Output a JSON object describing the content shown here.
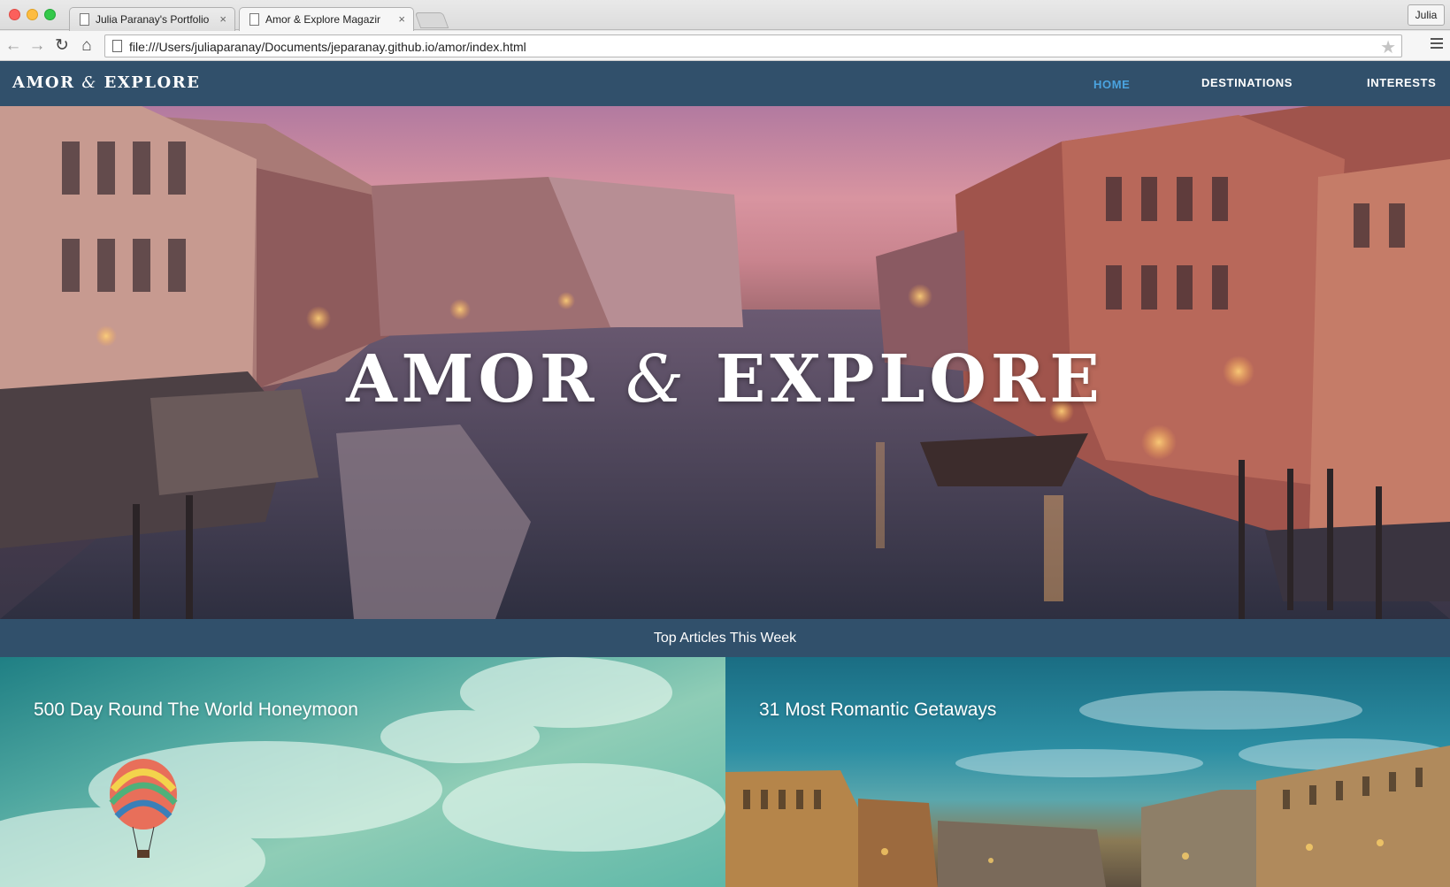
{
  "browser": {
    "tabs": [
      {
        "title": "Julia Paranay's Portfolio W",
        "close": "×"
      },
      {
        "title": "Amor & Explore Magazine",
        "close": "×"
      }
    ],
    "profile_label": "Julia",
    "url": "file:///Users/juliaparanay/Documents/jeparanay.github.io/amor/index.html",
    "icons": {
      "back": "back-icon",
      "forward": "forward-icon",
      "reload": "reload-icon",
      "home": "home-icon",
      "star": "star-icon",
      "menu": "menu-icon"
    }
  },
  "site": {
    "logo_left": "AMOR",
    "logo_amp": "&",
    "logo_right": "EXPLORE",
    "nav": {
      "home": "HOME",
      "destinations": "DESTINATIONS",
      "interests": "INTERESTS",
      "active_color": "#4aa3df"
    },
    "hero": {
      "title_left": "AMOR",
      "title_amp": "&",
      "title_right": "EXPLORE"
    },
    "section_title": "Top Articles This Week",
    "articles": [
      {
        "title": "500 Day Round The World Honeymoon"
      },
      {
        "title": "31 Most Romantic Getaways"
      }
    ],
    "colors": {
      "nav_bg": "#31506b",
      "text": "#ffffff"
    }
  }
}
